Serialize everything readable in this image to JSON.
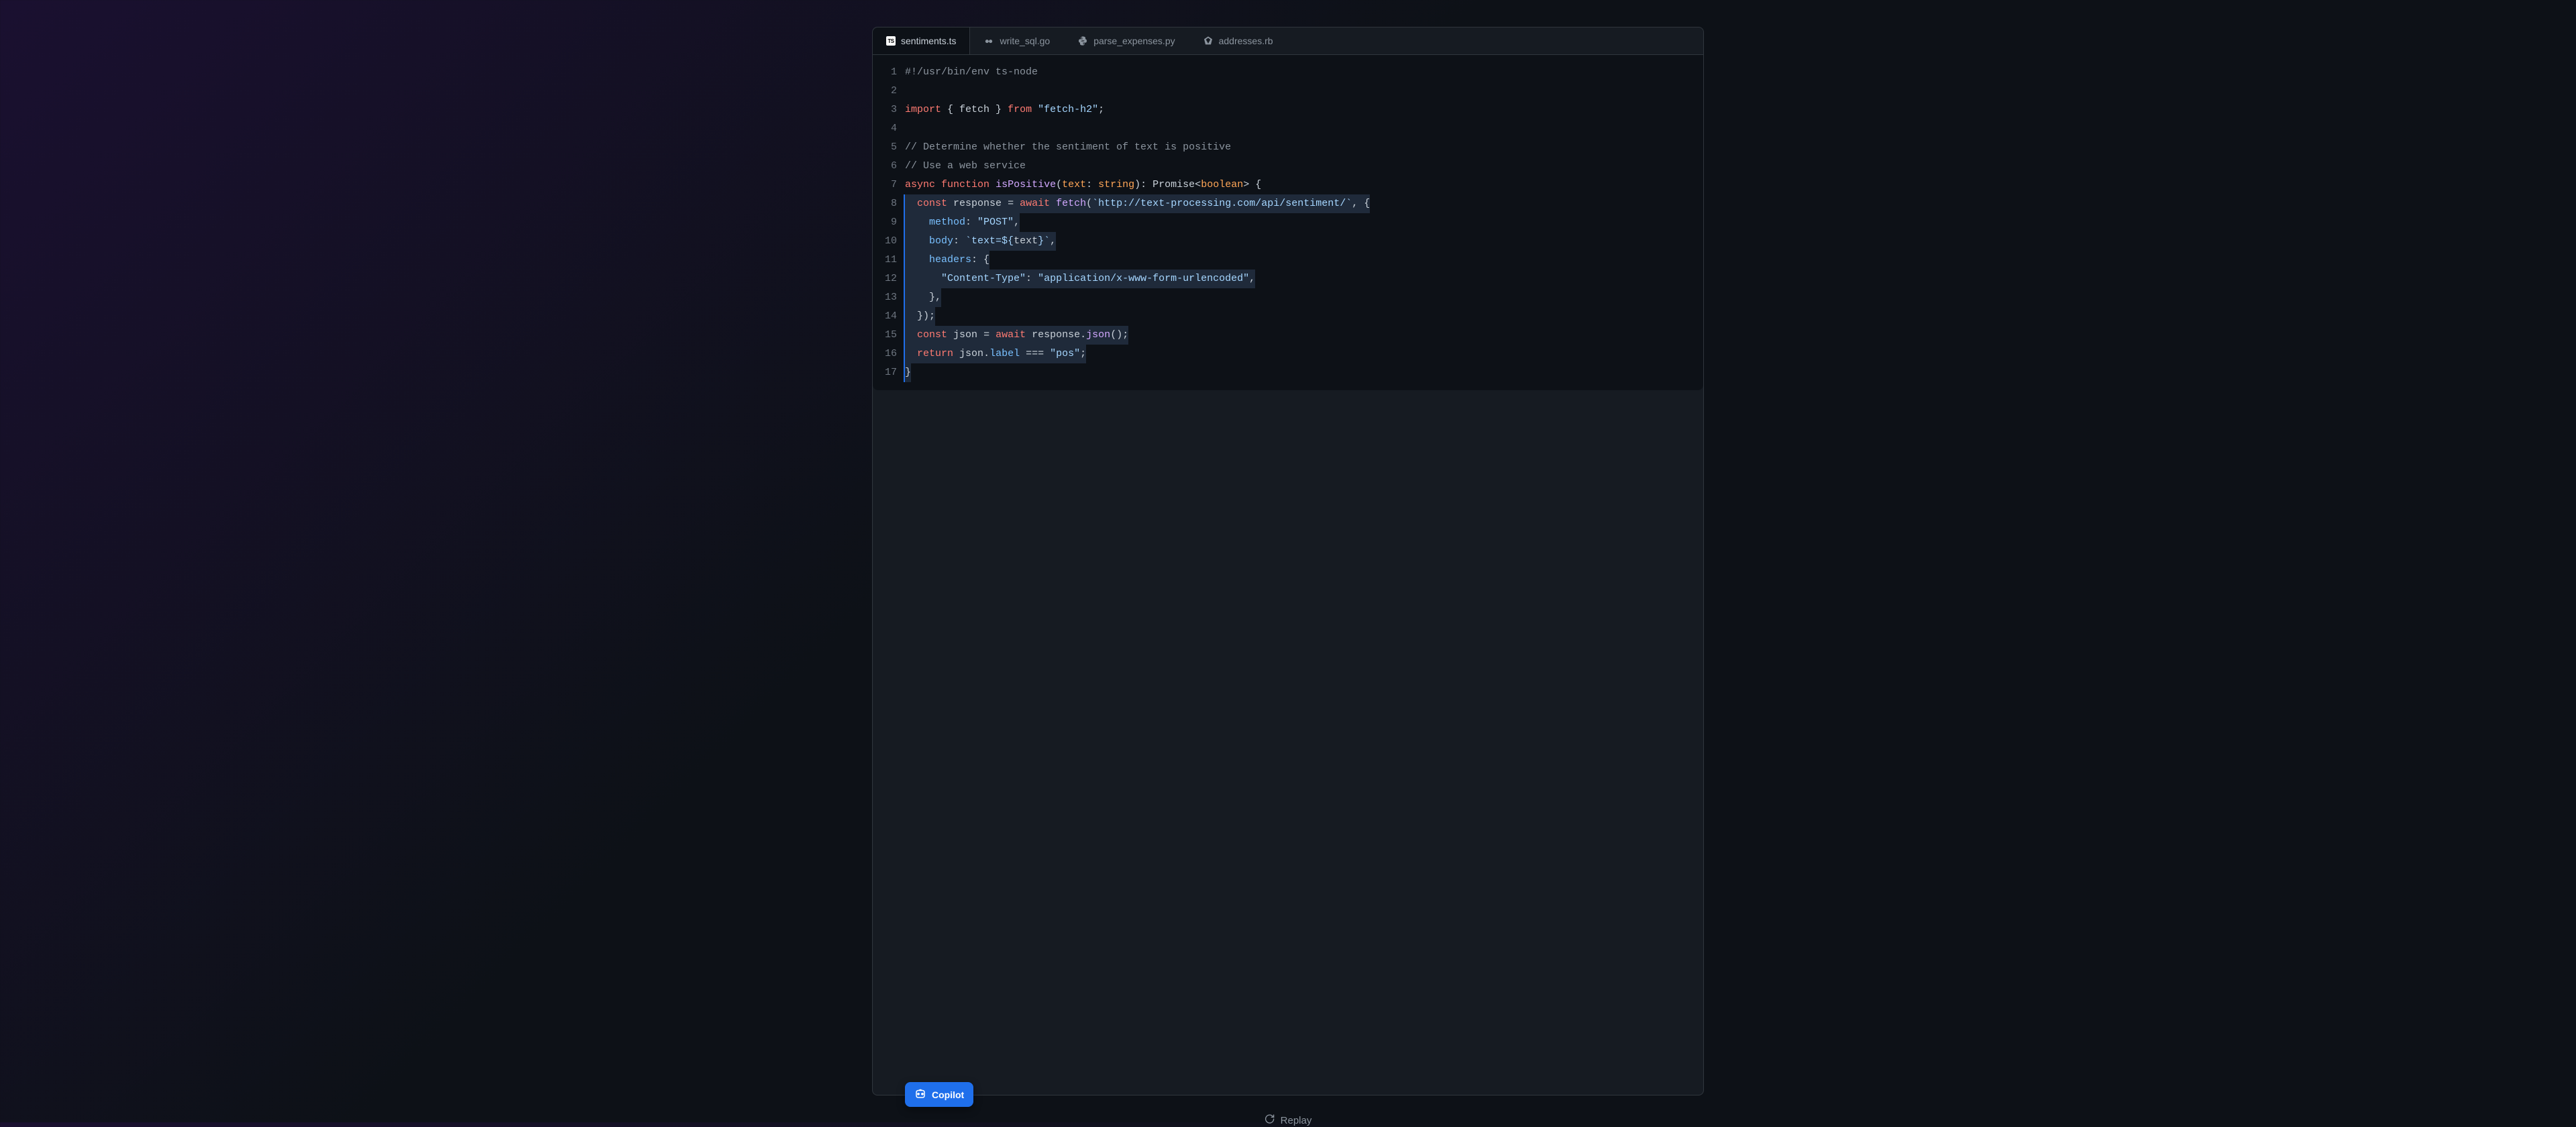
{
  "tabs": [
    {
      "label": "sentiments.ts",
      "icon": "TS",
      "active": true,
      "lang": "typescript"
    },
    {
      "label": "write_sql.go",
      "icon": "go",
      "active": false,
      "lang": "go"
    },
    {
      "label": "parse_expenses.py",
      "icon": "py",
      "active": false,
      "lang": "python"
    },
    {
      "label": "addresses.rb",
      "icon": "rb",
      "active": false,
      "lang": "ruby"
    }
  ],
  "code_lines": [
    {
      "n": 1,
      "hl": false,
      "tokens": [
        [
          "com",
          "#!/usr/bin/env ts-node"
        ]
      ]
    },
    {
      "n": 2,
      "hl": false,
      "tokens": [
        [
          "",
          ""
        ]
      ]
    },
    {
      "n": 3,
      "hl": false,
      "tokens": [
        [
          "kw",
          "import"
        ],
        [
          "",
          " { "
        ],
        [
          "var",
          "fetch"
        ],
        [
          "",
          " } "
        ],
        [
          "kw",
          "from"
        ],
        [
          "",
          " "
        ],
        [
          "str",
          "\"fetch-h2\""
        ],
        [
          "pun",
          ";"
        ]
      ]
    },
    {
      "n": 4,
      "hl": false,
      "tokens": [
        [
          "",
          ""
        ]
      ]
    },
    {
      "n": 5,
      "hl": false,
      "tokens": [
        [
          "com",
          "// Determine whether the sentiment of text is positive"
        ]
      ]
    },
    {
      "n": 6,
      "hl": false,
      "tokens": [
        [
          "com",
          "// Use a web service"
        ]
      ]
    },
    {
      "n": 7,
      "hl": false,
      "tokens": [
        [
          "kw",
          "async"
        ],
        [
          "",
          " "
        ],
        [
          "kw",
          "function"
        ],
        [
          "",
          " "
        ],
        [
          "fn",
          "isPositive"
        ],
        [
          "pun",
          "("
        ],
        [
          "type",
          "text"
        ],
        [
          "pun",
          ": "
        ],
        [
          "type",
          "string"
        ],
        [
          "pun",
          "): "
        ],
        [
          "var",
          "Promise"
        ],
        [
          "pun",
          "<"
        ],
        [
          "type",
          "boolean"
        ],
        [
          "pun",
          "> {"
        ]
      ]
    },
    {
      "n": 8,
      "hl": true,
      "tokens": [
        [
          "",
          "  "
        ],
        [
          "kw",
          "const"
        ],
        [
          "",
          " "
        ],
        [
          "var",
          "response"
        ],
        [
          "",
          " "
        ],
        [
          "pun",
          "="
        ],
        [
          "",
          " "
        ],
        [
          "kw",
          "await"
        ],
        [
          "",
          " "
        ],
        [
          "fn",
          "fetch"
        ],
        [
          "pun",
          "("
        ],
        [
          "str",
          "`http://text-processing.com/api/sentiment/`"
        ],
        [
          "pun",
          ", {"
        ]
      ]
    },
    {
      "n": 9,
      "hl": true,
      "tokens": [
        [
          "",
          "    "
        ],
        [
          "prop",
          "method"
        ],
        [
          "pun",
          ": "
        ],
        [
          "str",
          "\"POST\""
        ],
        [
          "pun",
          ","
        ]
      ]
    },
    {
      "n": 10,
      "hl": true,
      "tokens": [
        [
          "",
          "    "
        ],
        [
          "prop",
          "body"
        ],
        [
          "pun",
          ": "
        ],
        [
          "str",
          "`text=${"
        ],
        [
          "var",
          "text"
        ],
        [
          "str",
          "}`"
        ],
        [
          "pun",
          ","
        ]
      ]
    },
    {
      "n": 11,
      "hl": true,
      "tokens": [
        [
          "",
          "    "
        ],
        [
          "prop",
          "headers"
        ],
        [
          "pun",
          ": {"
        ]
      ]
    },
    {
      "n": 12,
      "hl": true,
      "tokens": [
        [
          "",
          "      "
        ],
        [
          "str",
          "\"Content-Type\""
        ],
        [
          "pun",
          ": "
        ],
        [
          "str",
          "\"application/x-www-form-urlencoded\""
        ],
        [
          "pun",
          ","
        ]
      ]
    },
    {
      "n": 13,
      "hl": true,
      "tokens": [
        [
          "",
          "    "
        ],
        [
          "pun",
          "},"
        ]
      ]
    },
    {
      "n": 14,
      "hl": true,
      "tokens": [
        [
          "",
          "  "
        ],
        [
          "pun",
          "});"
        ]
      ]
    },
    {
      "n": 15,
      "hl": true,
      "tokens": [
        [
          "",
          "  "
        ],
        [
          "kw",
          "const"
        ],
        [
          "",
          " "
        ],
        [
          "var",
          "json"
        ],
        [
          "",
          " "
        ],
        [
          "pun",
          "="
        ],
        [
          "",
          " "
        ],
        [
          "kw",
          "await"
        ],
        [
          "",
          " "
        ],
        [
          "var",
          "response"
        ],
        [
          "pun",
          "."
        ],
        [
          "fn",
          "json"
        ],
        [
          "pun",
          "();"
        ]
      ]
    },
    {
      "n": 16,
      "hl": true,
      "tokens": [
        [
          "",
          "  "
        ],
        [
          "kw",
          "return"
        ],
        [
          "",
          " "
        ],
        [
          "var",
          "json"
        ],
        [
          "pun",
          "."
        ],
        [
          "prop",
          "label"
        ],
        [
          "",
          " "
        ],
        [
          "pun",
          "==="
        ],
        [
          "",
          " "
        ],
        [
          "str",
          "\"pos\""
        ],
        [
          "pun",
          ";"
        ]
      ]
    },
    {
      "n": 17,
      "hl": true,
      "tokens": [
        [
          "pun",
          "}"
        ]
      ]
    }
  ],
  "badge": {
    "label": "Copilot"
  },
  "replay": {
    "label": "Replay"
  }
}
